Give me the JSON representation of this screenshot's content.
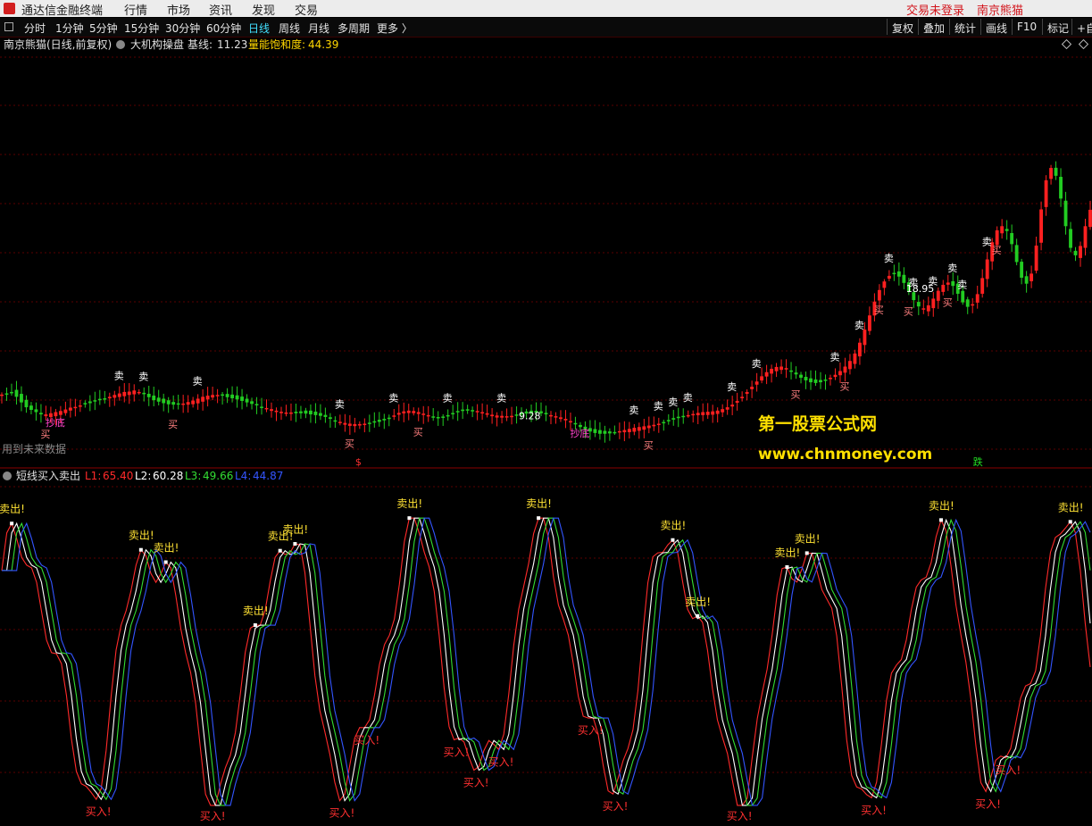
{
  "app_title": "通达信金融终端",
  "menu": [
    "行情",
    "市场",
    "资讯",
    "发现",
    "交易"
  ],
  "login_status": "交易未登录",
  "stock_name": "南京熊猫",
  "periods": [
    "分时",
    "1分钟",
    "5分钟",
    "15分钟",
    "30分钟",
    "60分钟",
    "日线",
    "周线",
    "月线",
    "多周期",
    "更多 〉"
  ],
  "active_period": "日线",
  "tools": [
    "复权",
    "叠加",
    "统计",
    "画线",
    "F10",
    "标记",
    "+自"
  ],
  "main_header": {
    "title": "南京熊猫(日线,前复权)",
    "indicator": "大机构操盘",
    "base_label": "基线:",
    "base_value": "11.23",
    "energy_label": "量能饱和度:",
    "energy_value": "44.39"
  },
  "future_data_note": "用到未来数据",
  "sub_header": {
    "indicator": "短线买入卖出",
    "lines": [
      {
        "label": "L1:",
        "value": "65.40",
        "color": "#ff2a2a"
      },
      {
        "label": "L2:",
        "value": "60.28",
        "color": "#ffffff"
      },
      {
        "label": "L3:",
        "value": "49.66",
        "color": "#33dd33"
      },
      {
        "label": "L4:",
        "value": "44.87",
        "color": "#3355ff"
      }
    ]
  },
  "watermark": {
    "line1": "第一股票公式网",
    "line2": "www.chnmoney.com"
  },
  "colors": {
    "up": "#ff2020",
    "down": "#22cc22",
    "sell": "#ffffff",
    "highlight": "#ffd000",
    "buy": "#ff8080",
    "sub_sell": "#ffe233",
    "sub_buy": "#ff3030",
    "grid": "#5a0000"
  },
  "chart_data": [
    {
      "type": "candlestick",
      "x_count": 220,
      "closes": [
        10.51,
        10.52,
        10.56,
        10.45,
        10.3,
        10.17,
        10.1,
        10.04,
        9.98,
        9.98,
        10.01,
        10.04,
        10.07,
        10.11,
        10.16,
        10.18,
        10.22,
        10.25,
        10.28,
        10.33,
        10.37,
        10.4,
        10.45,
        10.5,
        10.54,
        10.58,
        10.59,
        10.62,
        10.58,
        10.52,
        10.44,
        10.36,
        10.32,
        10.28,
        10.25,
        10.24,
        10.25,
        10.27,
        10.31,
        10.35,
        10.4,
        10.45,
        10.48,
        10.5,
        10.5,
        10.48,
        10.44,
        10.41,
        10.38,
        10.34,
        10.3,
        10.26,
        10.22,
        10.18,
        10.15,
        10.12,
        10.08,
        10.05,
        10.03,
        10.03,
        10.01,
        10.01,
        10.0,
        9.98,
        9.96,
        9.94,
        9.91,
        9.86,
        9.82,
        9.78,
        9.75,
        9.73,
        9.72,
        9.72,
        9.73,
        9.74,
        9.76,
        9.78,
        9.82,
        9.88,
        9.95,
        10.02,
        10.06,
        10.08,
        10.07,
        10.04,
        10.0,
        9.96,
        9.91,
        9.89,
        9.9,
        9.94,
        9.99,
        10.04,
        10.07,
        10.08,
        10.08,
        10.07,
        10.04,
        10.01,
        9.97,
        9.95,
        9.94,
        9.93,
        9.94,
        9.96,
        9.98,
        10.0,
        10.01,
        10.02,
        10.01,
        9.98,
        9.96,
        9.93,
        9.9,
        9.86,
        9.8,
        9.72,
        9.64,
        9.57,
        9.52,
        9.48,
        9.46,
        9.46,
        9.47,
        9.5,
        9.53,
        9.56,
        9.59,
        9.62,
        9.64,
        9.66,
        9.68,
        9.7,
        9.73,
        9.76,
        9.8,
        9.84,
        9.88,
        9.92,
        9.96,
        9.99,
        10.02,
        10.04,
        10.05,
        10.06,
        10.08,
        10.12,
        10.17,
        10.24,
        10.34,
        10.45,
        10.58,
        10.72,
        10.86,
        11.0,
        11.11,
        11.2,
        11.25,
        11.26,
        11.22,
        11.14,
        11.05,
        10.96,
        10.89,
        10.84,
        10.82,
        10.84,
        10.88,
        10.96,
        11.04,
        11.14,
        11.26,
        11.41,
        11.61,
        11.9,
        12.25,
        12.63,
        13.0,
        13.31,
        13.54,
        13.69,
        13.74,
        13.67,
        13.5,
        13.27,
        13.04,
        12.87,
        12.82,
        12.9,
        13.08,
        13.29,
        13.45,
        13.51,
        13.42,
        13.21,
        12.98,
        12.86,
        12.93,
        13.2,
        13.63,
        14.13,
        14.59,
        14.91,
        15.02,
        14.89,
        14.54,
        14.06,
        13.64,
        13.48,
        13.75,
        14.5,
        15.47,
        16.25,
        16.58,
        16.37,
        15.76,
        15.02,
        14.44,
        14.24,
        14.49,
        15.02,
        15.46
      ],
      "sell_labels": [
        {
          "x": 47,
          "text": "卖"
        },
        {
          "x": 57,
          "text": "卖"
        },
        {
          "x": 79,
          "text": "卖"
        },
        {
          "x": 137,
          "text": "卖"
        },
        {
          "x": 160,
          "text": "卖"
        },
        {
          "x": 181,
          "text": "卖"
        },
        {
          "x": 204,
          "text": "卖"
        },
        {
          "x": 258,
          "text": "卖"
        },
        {
          "x": 267,
          "text": "卖"
        },
        {
          "x": 273,
          "text": "卖"
        },
        {
          "x": 279,
          "text": "卖"
        },
        {
          "x": 298,
          "text": "卖"
        },
        {
          "x": 307,
          "text": "卖"
        },
        {
          "x": 339,
          "text": "卖"
        },
        {
          "x": 349,
          "text": "卖"
        },
        {
          "x": 361,
          "text": "卖"
        },
        {
          "x": 372,
          "text": "卖"
        },
        {
          "x": 387,
          "text": "卖"
        },
        {
          "x": 402,
          "text": "卖"
        },
        {
          "x": 380,
          "text": "卖"
        },
        {
          "x": 392,
          "text": "卖"
        }
      ],
      "buy_labels": [
        {
          "x": 18,
          "text": "买"
        },
        {
          "x": 69,
          "text": "买"
        },
        {
          "x": 141,
          "text": "买"
        },
        {
          "x": 169,
          "text": "买"
        },
        {
          "x": 264,
          "text": "买"
        },
        {
          "x": 323,
          "text": "买"
        },
        {
          "x": 343,
          "text": "买"
        },
        {
          "x": 358,
          "text": "买"
        },
        {
          "x": 369,
          "text": "买"
        },
        {
          "x": 386,
          "text": "买"
        },
        {
          "x": 405,
          "text": "买"
        }
      ],
      "dip_labels": [
        {
          "x": 20,
          "text": "抄底"
        },
        {
          "x": 234,
          "text": "抄底"
        }
      ],
      "annotations": [
        {
          "x": 389,
          "text": "18.95"
        },
        {
          "x": 232,
          "text": "9.28"
        }
      ],
      "bottom_markers": [
        {
          "x": 145,
          "text": "$"
        },
        {
          "x": 397,
          "text": "跌"
        }
      ]
    },
    {
      "type": "line",
      "series_count": 4,
      "x_count": 220,
      "ylim": [
        -5,
        110
      ],
      "sell_text": "卖出!",
      "buy_text": "买入!"
    }
  ]
}
